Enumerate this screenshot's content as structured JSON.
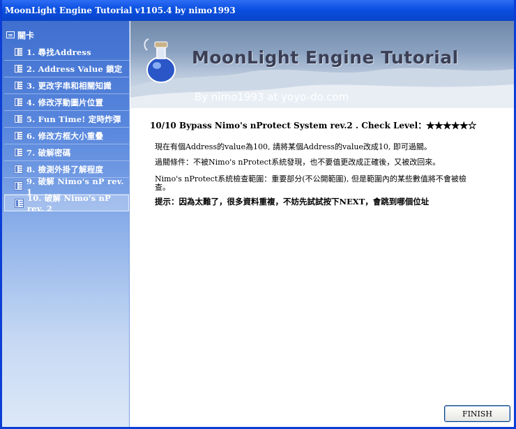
{
  "window": {
    "title": "MoonLight Engine Tutorial v1105.4 by nimo1993"
  },
  "sidebar": {
    "header": "關卡",
    "items": [
      {
        "label": "1. 尋找Address",
        "active": false
      },
      {
        "label": "2. Address Value 鎖定",
        "active": false
      },
      {
        "label": "3. 更改字串和相關知識",
        "active": false
      },
      {
        "label": "4. 修改浮動圖片位置",
        "active": false
      },
      {
        "label": "5. Fun Time! 定時炸彈",
        "active": false
      },
      {
        "label": "6. 修改方框大小重疊",
        "active": false
      },
      {
        "label": "7. 破解密碼",
        "active": false
      },
      {
        "label": "8. 檢測外掛了解程度",
        "active": false
      },
      {
        "label": "9. 破解 Nimo's nP rev. 1",
        "active": false
      },
      {
        "label": "10. 破解 Nimo's nP rev. 2",
        "active": true
      }
    ]
  },
  "banner": {
    "title": "MoonLight Engine Tutorial",
    "credit": "By nimo1993 at yoyo-do.com"
  },
  "content": {
    "heading": "10/10 Bypass Nimo's nProtect System rev.2 . Check Level：★★★★★☆",
    "p1": "現在有個Address的value為100, 請將某個Address的value改成10, 即可過關。",
    "p2": "過關條件：不被Nimo's nProtect系統發現，也不要值更改成正確後，又被改回來。",
    "p3": "Nimo's nProtect系統檢查範圍：重要部分(不公開範圍), 但是範圍內的某些數值將不會被檢查。",
    "p4": "提示：因為太難了，很多資料重複，不妨先試試按下NEXT，會跳到哪個位址"
  },
  "footer": {
    "finish_label": "FINISH"
  },
  "colors": {
    "titlebar": "#0a4fe0",
    "sidebar_top": "#3f6fd0",
    "banner_text": "#3b3f56"
  }
}
